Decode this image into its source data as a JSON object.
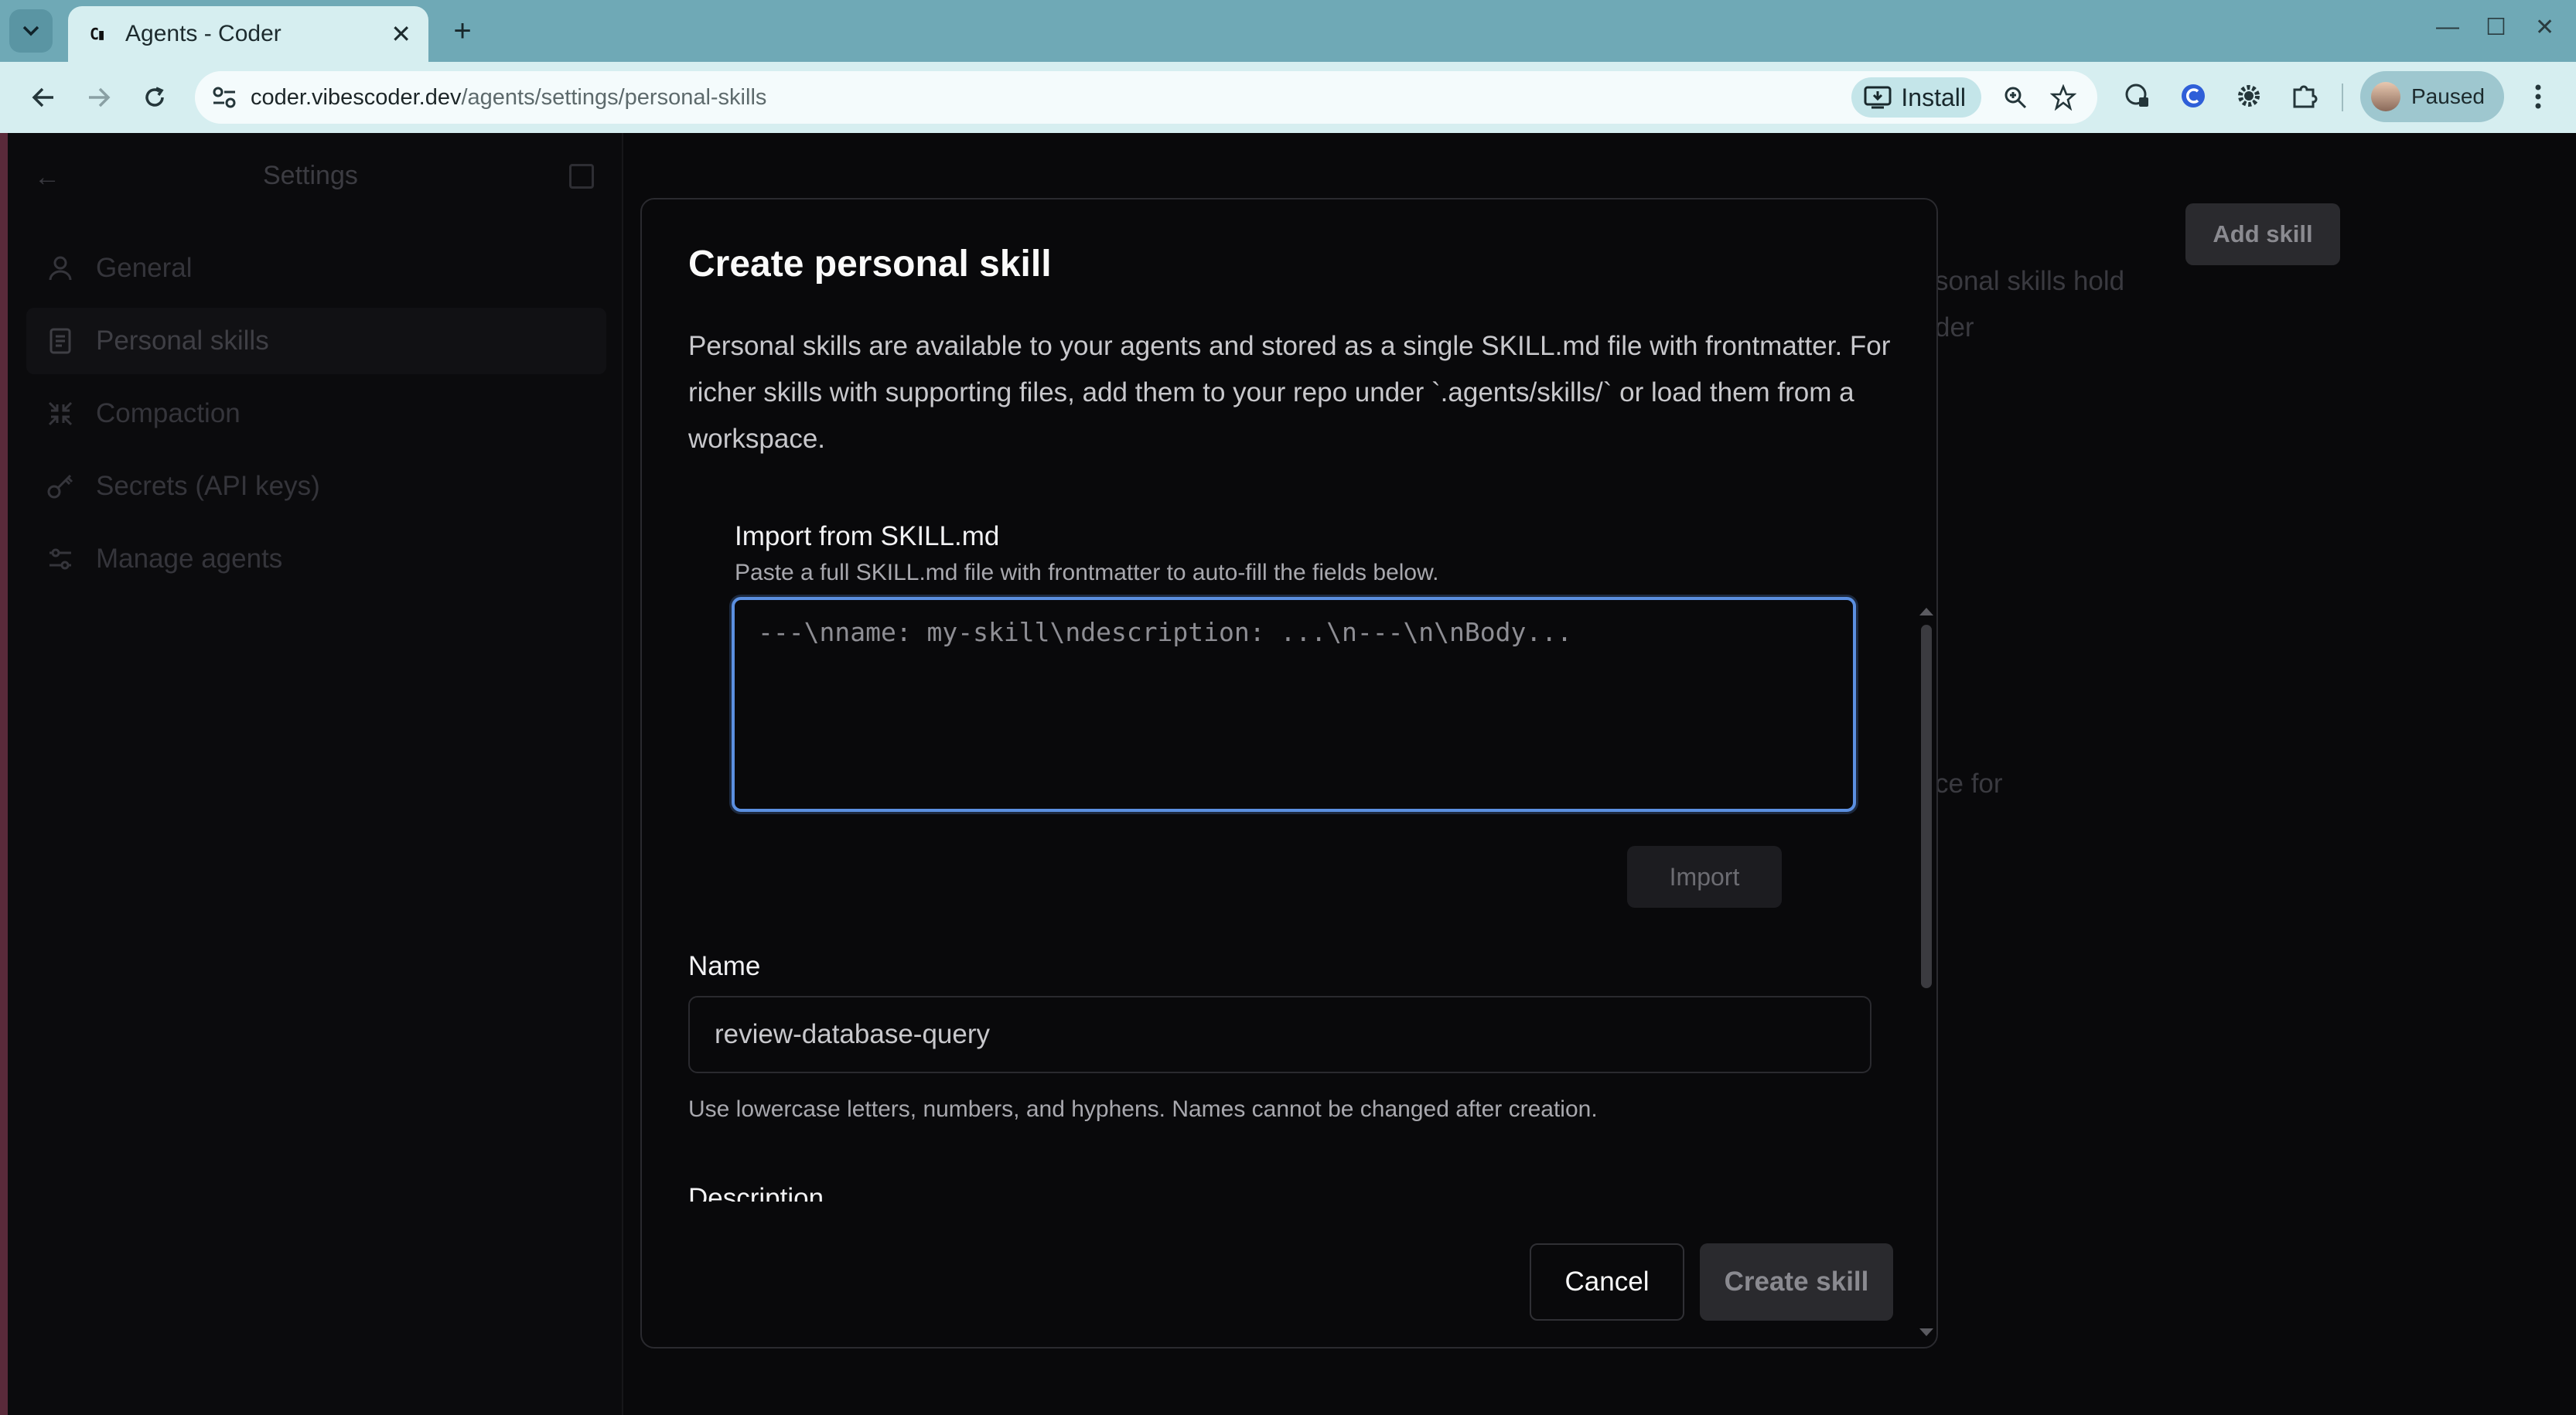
{
  "browser": {
    "tab_title": "Agents - Coder",
    "url_host": "coder.vibescoder.dev",
    "url_path": "/agents/settings/personal-skills",
    "install_label": "Install",
    "profile_label": "Paused"
  },
  "sidebar": {
    "title": "Settings",
    "items": [
      {
        "label": "General",
        "icon": "user-icon"
      },
      {
        "label": "Personal skills",
        "icon": "document-icon"
      },
      {
        "label": "Compaction",
        "icon": "compress-icon"
      },
      {
        "label": "Secrets (API keys)",
        "icon": "key-icon"
      },
      {
        "label": "Manage agents",
        "icon": "sliders-icon"
      }
    ]
  },
  "background": {
    "add_skill_label": "Add skill",
    "text_1": "sonal skills hold",
    "text_2": "der",
    "text_3": "ce for"
  },
  "modal": {
    "title": "Create personal skill",
    "intro": "Personal skills are available to your agents and stored as a single SKILL.md file with frontmatter. For richer skills with supporting files, add them to your repo under `.agents/skills/` or load them from a workspace.",
    "import": {
      "title": "Import from SKILL.md",
      "subtitle": "Paste a full SKILL.md file with frontmatter to auto-fill the fields below.",
      "placeholder": "---\\nname: my-skill\\ndescription: ...\\n---\\n\\nBody...",
      "button": "Import"
    },
    "name": {
      "label": "Name",
      "value": "review-database-query",
      "help": "Use lowercase letters, numbers, and hyphens. Names cannot be changed after creation."
    },
    "description_label": "Description",
    "cancel": "Cancel",
    "create": "Create skill"
  },
  "colors": {
    "accent_focus": "#5b8fe0",
    "chrome_tabbar": "#6fa9b6",
    "chrome_toolbar": "#d6eef0"
  }
}
